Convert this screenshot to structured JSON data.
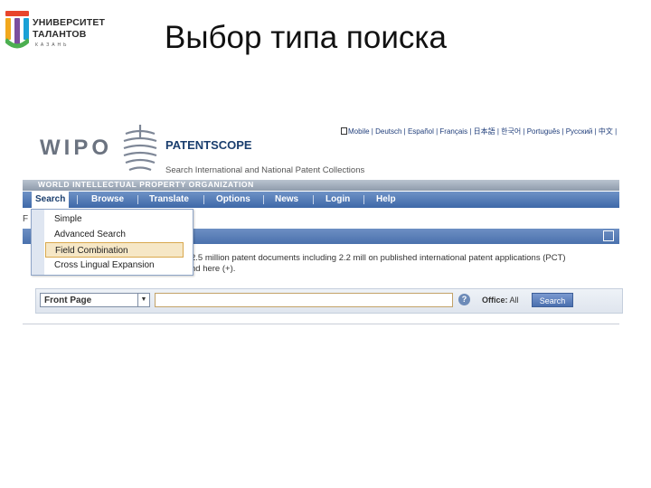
{
  "slide": {
    "logo_line1": "УНИВЕРСИТЕТ",
    "logo_line2": "ТАЛАНТОВ",
    "logo_line3": "КАЗАНЬ",
    "title": "Выбор типа поиска"
  },
  "site": {
    "logo": "WIPO",
    "product": "PATENTSCOPE",
    "subtitle": "Search International and National Patent Collections",
    "languages": "Mobile | Deutsch | Español | Français | 日本語 | 한국어 | Português | Русский | 中文 |",
    "org_bar": "WORLD INTELLECTUAL PROPERTY ORGANIZATION"
  },
  "nav": {
    "items": [
      "Search",
      "Browse",
      "Translate",
      "Options",
      "News",
      "Login",
      "Help"
    ]
  },
  "dropdown": {
    "items": [
      "Simple",
      "Advanced Search",
      "Field Combination",
      "Cross Lingual Expansion"
    ],
    "highlighted": "Field Combination"
  },
  "content": {
    "crumb": "F",
    "desc_line1": "2.5 million patent documents including 2.2 mill on published international patent applications (PCT)",
    "desc_line2": "nd here (+)."
  },
  "search": {
    "select_value": "Front Page",
    "input_value": "",
    "help_label": "?",
    "office_label": "Office:",
    "office_value": "All",
    "button_label": "Search"
  },
  "colors": {
    "nav_bar": "#3e68a8",
    "org_bar": "#8f9bab",
    "highlight": "#f6e7c6"
  }
}
